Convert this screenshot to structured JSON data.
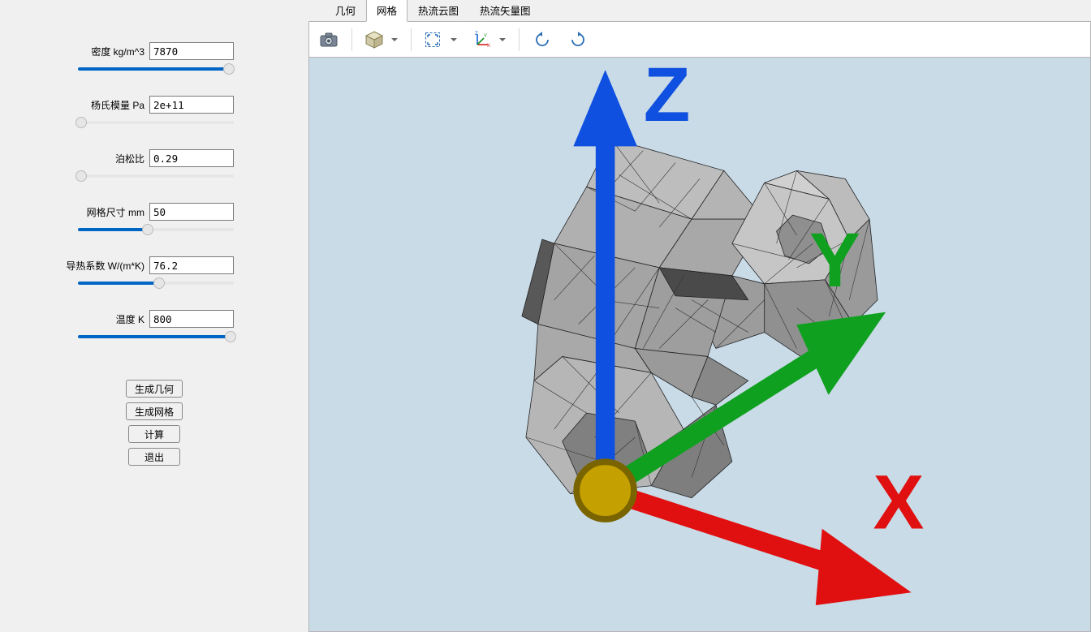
{
  "params": {
    "density": {
      "label": "密度 kg/m^3",
      "value": "7870",
      "pct": 97
    },
    "youngs": {
      "label": "杨氏模量 Pa",
      "value": "2e+11",
      "pct": 2
    },
    "poisson": {
      "label": "泊松比",
      "value": "0.29",
      "pct": 2
    },
    "meshsize": {
      "label": "网格尺寸 mm",
      "value": "50",
      "pct": 45
    },
    "thermal": {
      "label": "导热系数 W/(m*K)",
      "value": "76.2",
      "pct": 52
    },
    "temp": {
      "label": "温度 K",
      "value": "800",
      "pct": 98
    }
  },
  "buttons": {
    "gen_geom": "生成几何",
    "gen_mesh": "生成网格",
    "compute": "计算",
    "exit": "退出"
  },
  "tabs": {
    "geom": "几何",
    "mesh": "网格",
    "contour": "热流云图",
    "vector": "热流矢量图",
    "active": "mesh"
  },
  "triad": {
    "x": "X",
    "y": "Y",
    "z": "Z"
  },
  "toolbar_icons": {
    "camera": "camera-icon",
    "cube": "view-cube-icon",
    "fit": "fit-view-icon",
    "axes": "axes-icon",
    "rot_ccw": "rotate-ccw-icon",
    "rot_cw": "rotate-cw-icon"
  }
}
